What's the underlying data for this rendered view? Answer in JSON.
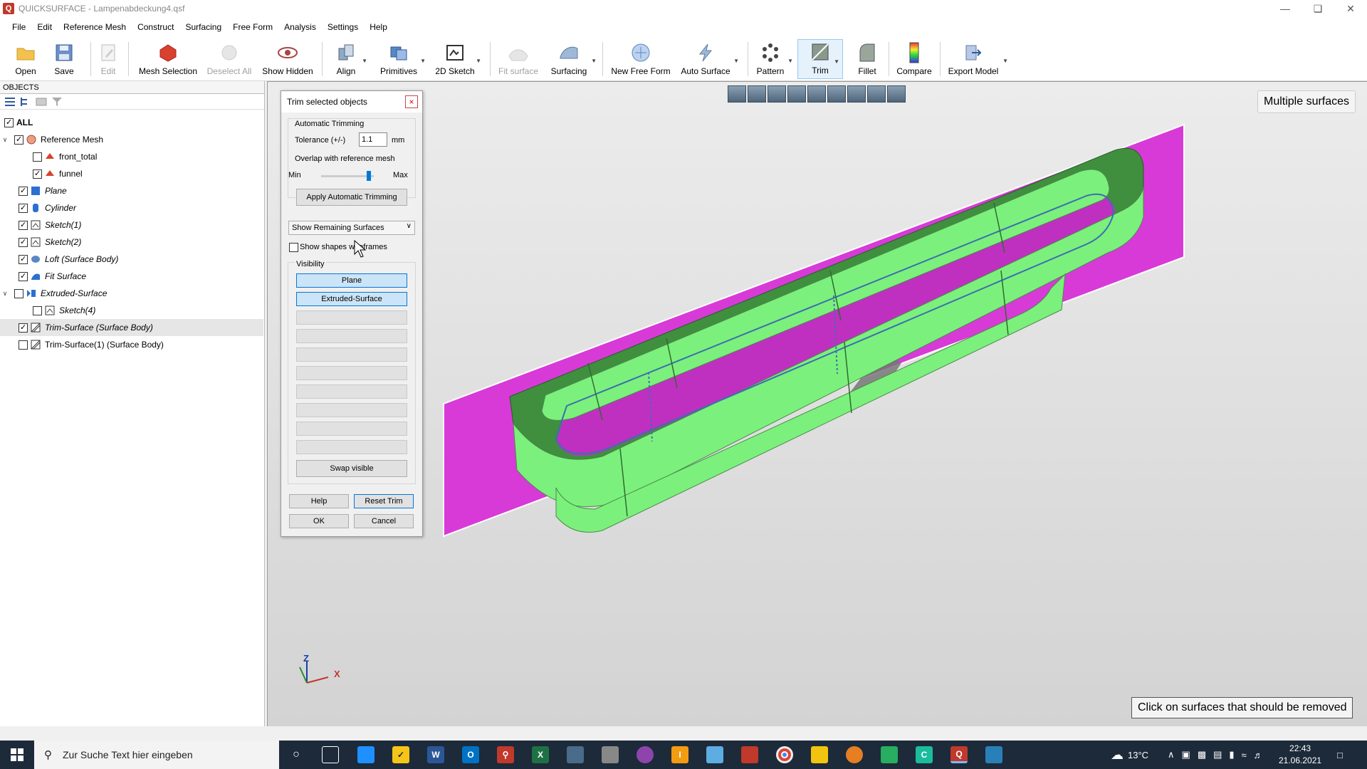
{
  "window": {
    "title": "QUICKSURFACE - Lampenabdeckung4.qsf",
    "app_initial": "Q"
  },
  "menu": [
    "File",
    "Edit",
    "Reference Mesh",
    "Construct",
    "Surfacing",
    "Free Form",
    "Analysis",
    "Settings",
    "Help"
  ],
  "toolbar": {
    "open": "Open",
    "save": "Save",
    "edit": "Edit",
    "mesh_selection": "Mesh Selection",
    "deselect_all": "Deselect All",
    "show_hidden": "Show Hidden",
    "align": "Align",
    "primitives": "Primitives",
    "sketch2d": "2D Sketch",
    "fit_surface": "Fit surface",
    "surfacing": "Surfacing",
    "new_free_form": "New Free Form",
    "auto_surface": "Auto Surface",
    "pattern": "Pattern",
    "trim": "Trim",
    "fillet": "Fillet",
    "compare": "Compare",
    "export_model": "Export Model"
  },
  "objects": {
    "header": "OBJECTS",
    "items": [
      {
        "label": "ALL",
        "checked": true
      },
      {
        "label": "Reference Mesh",
        "checked": true
      },
      {
        "label": "front_total",
        "checked": false
      },
      {
        "label": "funnel",
        "checked": true
      },
      {
        "label": "Plane",
        "checked": true
      },
      {
        "label": "Cylinder",
        "checked": true
      },
      {
        "label": "Sketch(1)",
        "checked": true
      },
      {
        "label": "Sketch(2)",
        "checked": true
      },
      {
        "label": "Loft (Surface Body)",
        "checked": true
      },
      {
        "label": "Fit Surface",
        "checked": true
      },
      {
        "label": "Extruded-Surface",
        "checked": false
      },
      {
        "label": "Sketch(4)",
        "checked": false
      },
      {
        "label": "Trim-Surface (Surface Body)",
        "checked": true
      },
      {
        "label": "Trim-Surface(1) (Surface Body)",
        "checked": false
      }
    ]
  },
  "dialog": {
    "title": "Trim selected objects",
    "auto_trimming": "Automatic Trimming",
    "tolerance_label": "Tolerance (+/-)",
    "tolerance_value": "1.1",
    "tolerance_unit": "mm",
    "overlap_label": "Overlap with reference mesh",
    "overlap_level": 0.9,
    "min": "Min",
    "max": "Max",
    "apply_auto": "Apply Automatic Trimming",
    "show_mode": "Show Remaining Surfaces",
    "show_wireframes": "Show shapes wireframes",
    "visibility": "Visibility",
    "visible_items": [
      "Plane",
      "Extruded-Surface"
    ],
    "swap_visible": "Swap visible",
    "help": "Help",
    "reset_trim": "Reset Trim",
    "ok": "OK",
    "cancel": "Cancel"
  },
  "viewport": {
    "top_badge": "Multiple surfaces",
    "bottom_badge": "Click on surfaces that should be removed",
    "axis_z": "Z",
    "axis_x": "X",
    "colors": {
      "plane": "#d83ad8",
      "surface": "#7cf07c",
      "surface_dark": "#3f8f3f"
    }
  },
  "taskbar": {
    "search_placeholder": "Zur Suche Text hier eingeben",
    "temperature": "13°C",
    "time": "22:43",
    "date": "21.06.2021"
  }
}
